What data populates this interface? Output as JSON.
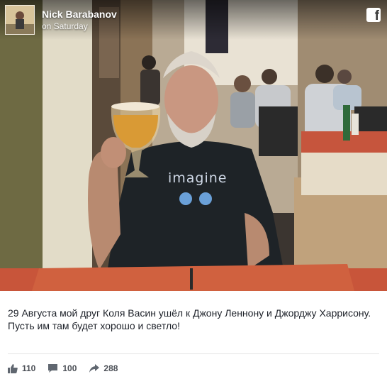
{
  "header": {
    "author": "Nick Barabanov",
    "timestamp": "on Saturday",
    "platform_icon": "facebook-icon"
  },
  "photo": {
    "shirt_text": "imagine"
  },
  "post": {
    "lines": [
      "29 Августа мой друг Коля Васин ушёл к Джону Леннону и Джорджу Харрисону.",
      "Пусть им там будет хорошо и светло!"
    ]
  },
  "stats": {
    "likes": "110",
    "comments": "100",
    "shares": "288"
  },
  "colors": {
    "text": "#1d2129",
    "stats": "#4b4f56",
    "tablecloth": "#c8553a"
  }
}
